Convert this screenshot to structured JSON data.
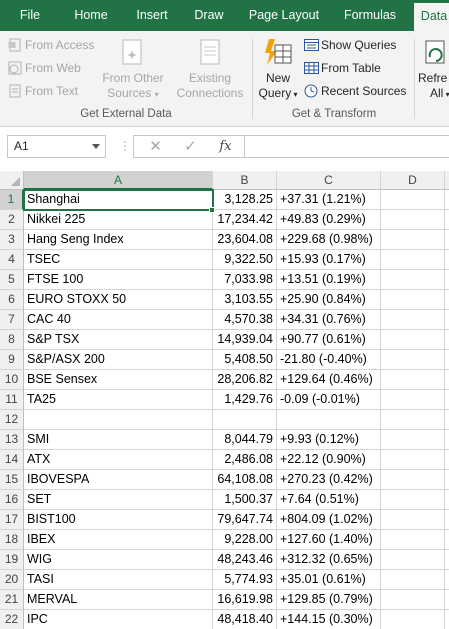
{
  "ribbon_tabs": [
    "File",
    "Home",
    "Insert",
    "Draw",
    "Page Layout",
    "Formulas",
    "Data"
  ],
  "active_tab": "Data",
  "get_external_data": {
    "from_access": "From Access",
    "from_web": "From Web",
    "from_text": "From Text",
    "from_other_sources_1": "From Other",
    "from_other_sources_2": "Sources",
    "existing_connections_1": "Existing",
    "existing_connections_2": "Connections",
    "group_label": "Get External Data"
  },
  "get_transform": {
    "new_query_1": "New",
    "new_query_2": "Query",
    "show_queries": "Show Queries",
    "from_table": "From Table",
    "recent_sources": "Recent Sources",
    "group_label": "Get & Transform"
  },
  "refresh_all_1": "Refre",
  "refresh_all_2": "All",
  "formula_bar": {
    "name_box": "A1",
    "cancel_glyph": "✕",
    "enter_glyph": "✓",
    "fx_glyph": "fx",
    "separator_glyph": "⋮",
    "value": ""
  },
  "columns": [
    "A",
    "B",
    "C",
    "D"
  ],
  "selected_column": "A",
  "selected_row": 1,
  "rows": [
    {
      "n": "1",
      "a": "Shanghai",
      "b": "3,128.25",
      "c": "+37.31 (1.21%)"
    },
    {
      "n": "2",
      "a": "Nikkei 225",
      "b": "17,234.42",
      "c": "+49.83 (0.29%)"
    },
    {
      "n": "3",
      "a": "Hang Seng Index",
      "b": "23,604.08",
      "c": "+229.68 (0.98%)"
    },
    {
      "n": "4",
      "a": "TSEC",
      "b": "9,322.50",
      "c": "+15.93 (0.17%)"
    },
    {
      "n": "5",
      "a": "FTSE 100",
      "b": "7,033.98",
      "c": "+13.51 (0.19%)"
    },
    {
      "n": "6",
      "a": "EURO STOXX 50",
      "b": "3,103.55",
      "c": "+25.90 (0.84%)"
    },
    {
      "n": "7",
      "a": "CAC 40",
      "b": "4,570.38",
      "c": "+34.31 (0.76%)"
    },
    {
      "n": "8",
      "a": "S&P TSX",
      "b": "14,939.04",
      "c": "+90.77 (0.61%)"
    },
    {
      "n": "9",
      "a": "S&P/ASX 200",
      "b": "5,408.50",
      "c": "-21.80 (-0.40%)"
    },
    {
      "n": "10",
      "a": "BSE Sensex",
      "b": "28,206.82",
      "c": "+129.64 (0.46%)"
    },
    {
      "n": "11",
      "a": "TA25",
      "b": "1,429.76",
      "c": "-0.09 (-0.01%)"
    },
    {
      "n": "12",
      "a": "",
      "b": "",
      "c": ""
    },
    {
      "n": "13",
      "a": "SMI",
      "b": "8,044.79",
      "c": "+9.93 (0.12%)"
    },
    {
      "n": "14",
      "a": "ATX",
      "b": "2,486.08",
      "c": "+22.12 (0.90%)"
    },
    {
      "n": "15",
      "a": "IBOVESPA",
      "b": "64,108.08",
      "c": "+270.23 (0.42%)"
    },
    {
      "n": "16",
      "a": "SET",
      "b": "1,500.37",
      "c": "+7.64 (0.51%)"
    },
    {
      "n": "17",
      "a": "BIST100",
      "b": "79,647.74",
      "c": "+804.09 (1.02%)"
    },
    {
      "n": "18",
      "a": "IBEX",
      "b": "9,228.00",
      "c": "+127.60 (1.40%)"
    },
    {
      "n": "19",
      "a": "WIG",
      "b": "48,243.46",
      "c": "+312.32 (0.65%)"
    },
    {
      "n": "20",
      "a": "TASI",
      "b": "5,774.93",
      "c": "+35.01 (0.61%)"
    },
    {
      "n": "21",
      "a": "MERVAL",
      "b": "16,619.98",
      "c": "+129.85 (0.79%)"
    },
    {
      "n": "22",
      "a": "IPC",
      "b": "48,418.40",
      "c": "+144.15 (0.30%)"
    }
  ],
  "colors": {
    "excel_green": "#217346",
    "ribbon_bg": "#f3f3f3",
    "header_bg": "#f0f0f0",
    "selected_header_bg": "#d2d2d2",
    "gridline": "#d4d4d4"
  },
  "icons": [
    "access-icon",
    "web-icon",
    "text-file-icon",
    "other-sources-icon",
    "connections-icon",
    "new-query-icon",
    "show-queries-icon",
    "table-icon",
    "recent-sources-icon",
    "refresh-icon"
  ]
}
